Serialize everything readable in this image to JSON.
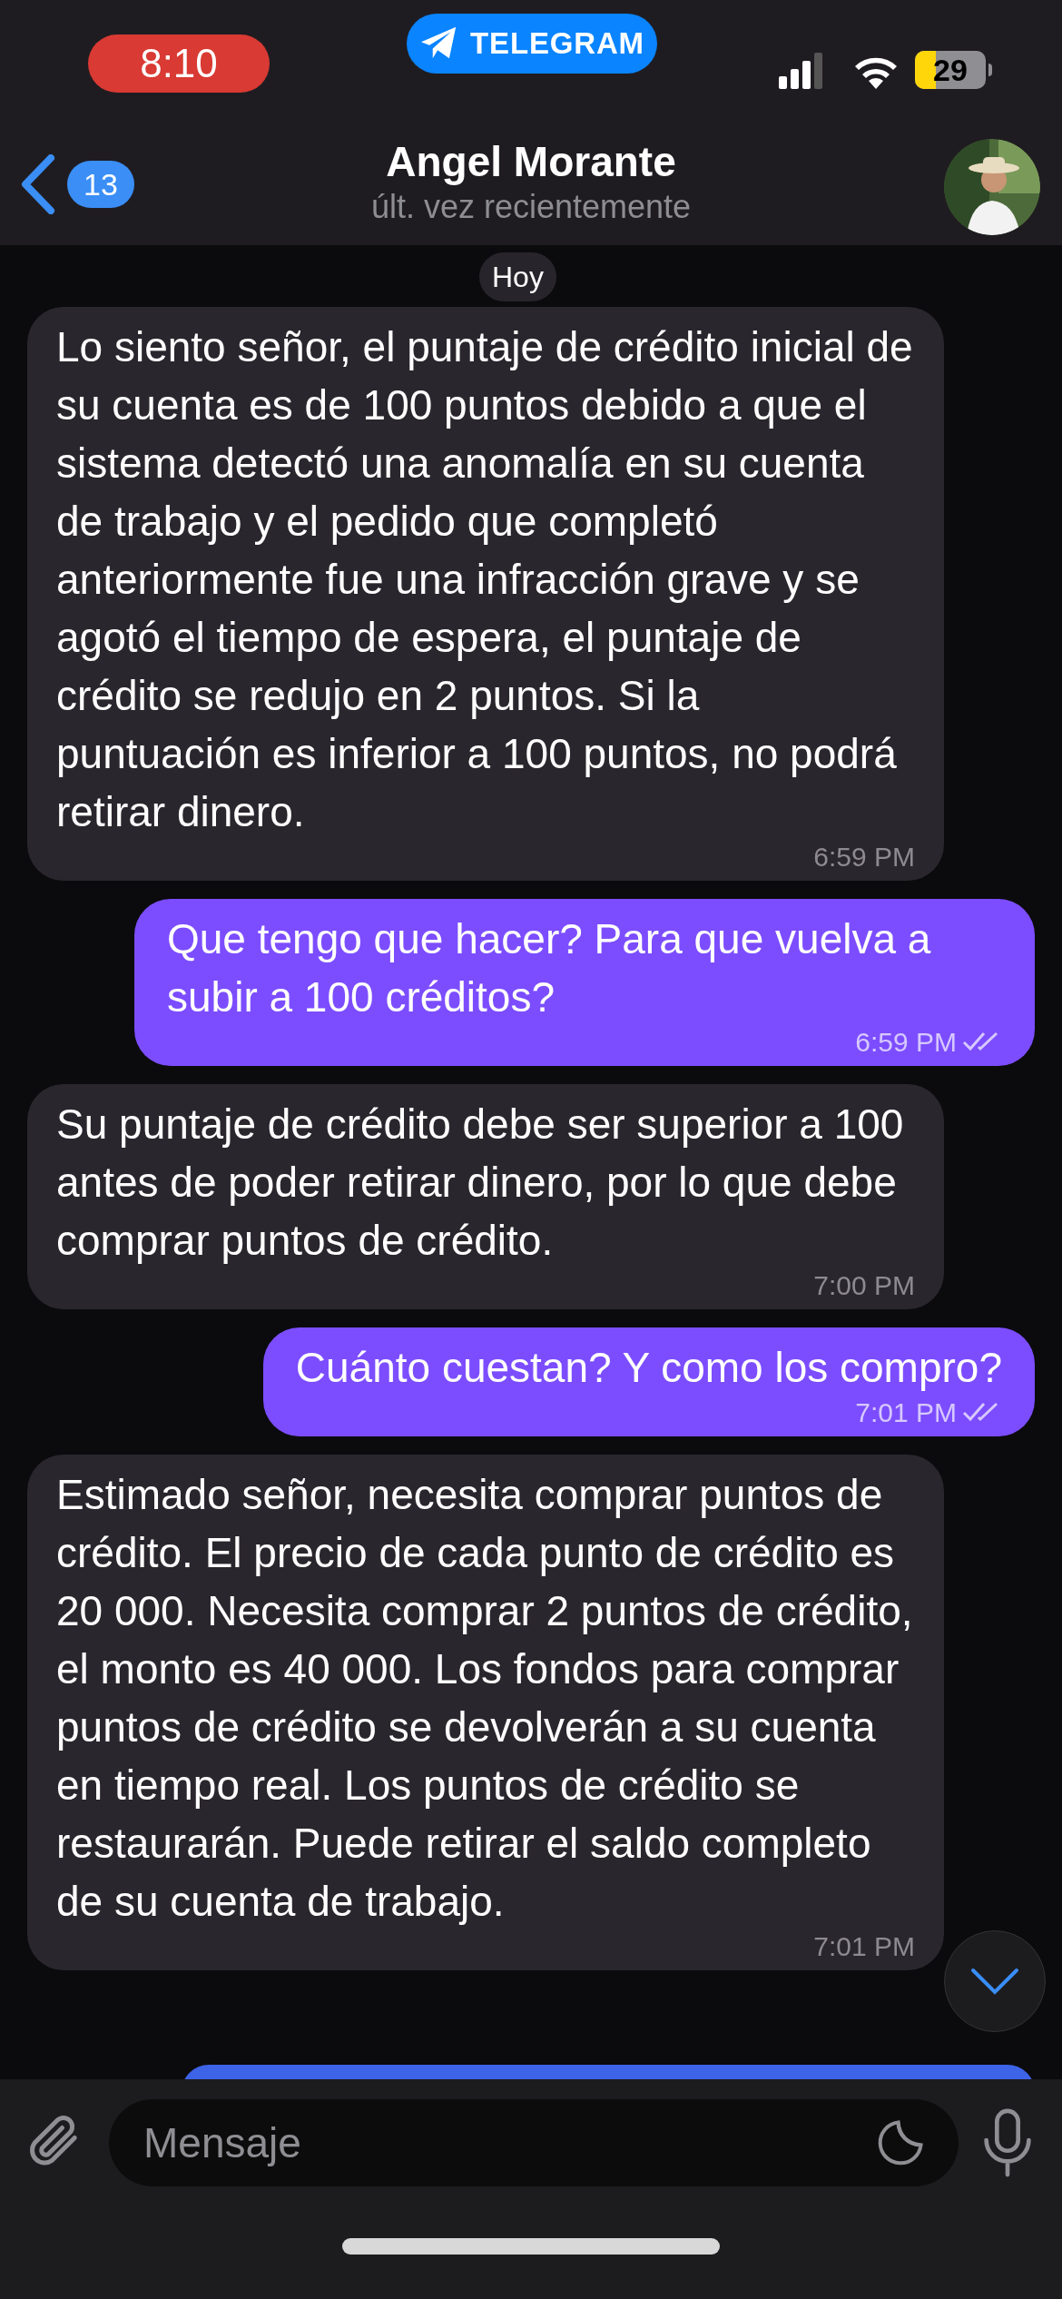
{
  "status_bar": {
    "time": "8:10",
    "app_pill": "TELEGRAM",
    "battery": "29"
  },
  "header": {
    "back_count": "13",
    "name": "Angel Morante",
    "subtitle": "últ. vez recientemente"
  },
  "date_pill": "Hoy",
  "messages": [
    {
      "outgoing": false,
      "text": "Lo siento señor, el puntaje de crédito inicial de su cuenta es de 100 puntos debido a que el sistema detectó una anomalía en su cuenta de trabajo y el pedido que completó anteriormente fue una infracción grave y se agotó el tiempo de espera, el puntaje de crédito se redujo en 2 puntos. Si la puntuación es inferior a 100 puntos, no podrá retirar dinero.",
      "time": "6:59 PM",
      "read": false
    },
    {
      "outgoing": true,
      "text": "Que tengo que hacer? Para que vuelva a subir a 100 créditos?",
      "time": "6:59 PM",
      "read": true
    },
    {
      "outgoing": false,
      "text": "Su puntaje de crédito debe ser superior a 100 antes de poder retirar dinero, por lo que debe comprar puntos de crédito.",
      "time": "7:00 PM",
      "read": false
    },
    {
      "outgoing": true,
      "text": "Cuánto cuestan? Y como los compro?",
      "time": "7:01 PM",
      "read": true
    },
    {
      "outgoing": false,
      "text": "Estimado señor, necesita comprar puntos de crédito. El precio de cada punto de crédito es 20 000. Necesita comprar 2 puntos de crédito, el monto es 40 000. Los fondos para comprar puntos de crédito se devolverán a su cuenta en tiempo real. Los puntos de crédito se restaurarán. Puede retirar el saldo completo de su cuenta de trabajo.",
      "time": "7:01 PM",
      "read": false
    }
  ],
  "composer": {
    "placeholder": "Mensaje"
  }
}
